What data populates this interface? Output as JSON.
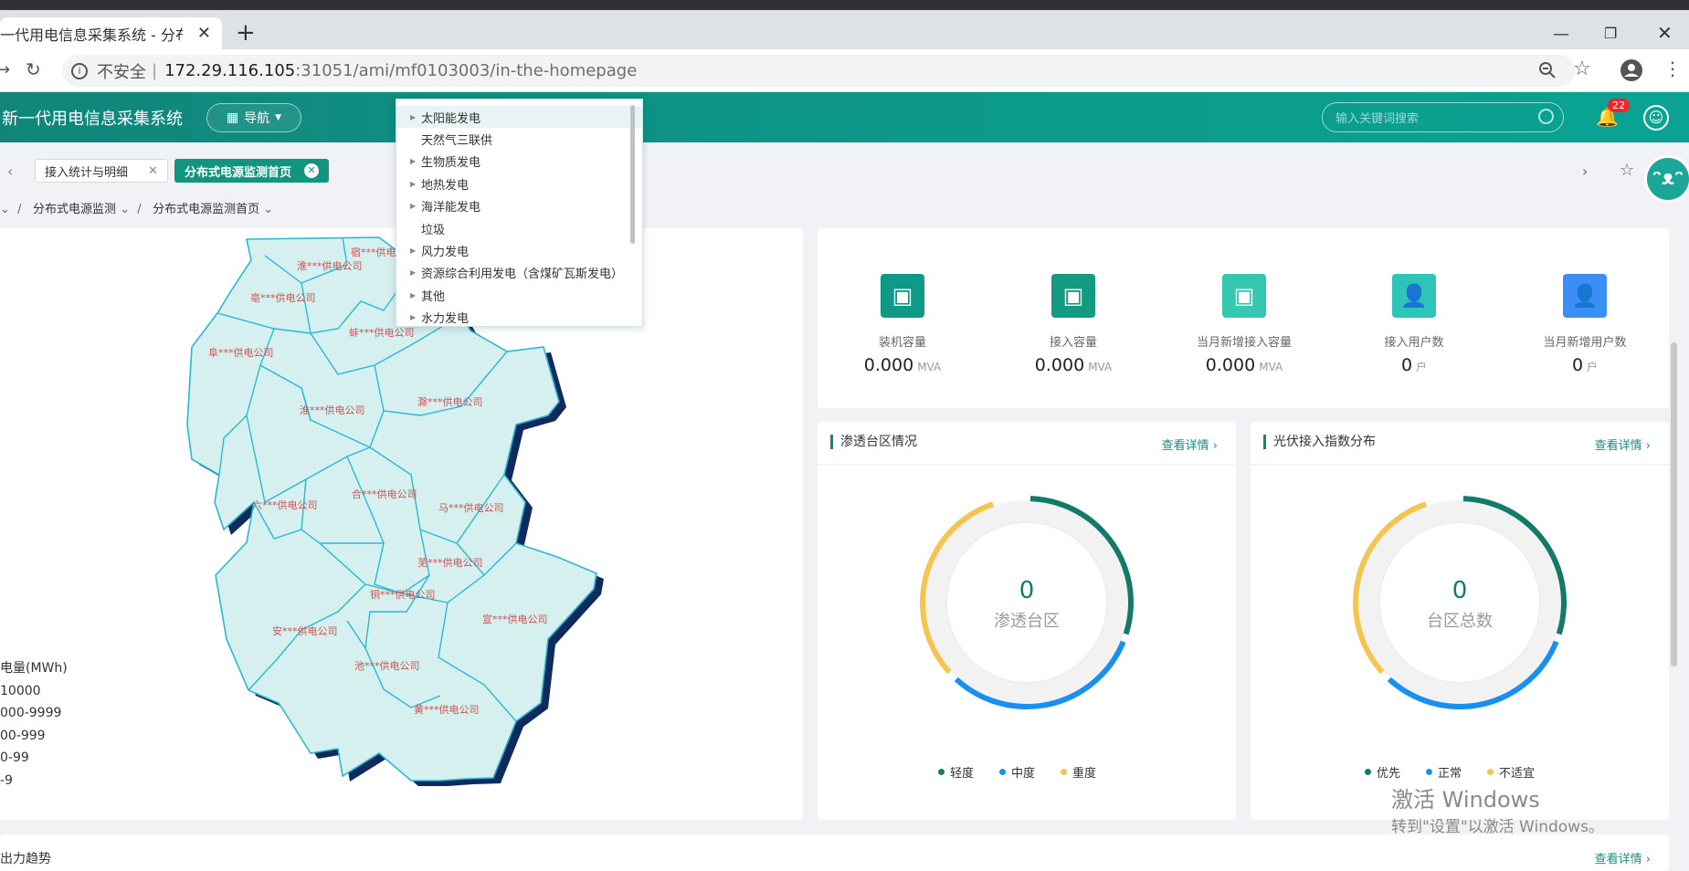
{
  "browser": {
    "tab_title": "一代用电信息采集系统 - 分布式",
    "url_insecure": "不安全",
    "url_host": "172.29.116.105",
    "url_rest": ":31051/ami/mf0103003/in-the-homepage"
  },
  "app": {
    "title": "新一代用电信息采集系统",
    "nav_label": "导航",
    "search_placeholder": "输入关键词搜索",
    "notification_count": "22"
  },
  "page_tabs": [
    {
      "label": "接入统计与明细",
      "active": false
    },
    {
      "label": "分布式电源监测首页",
      "active": true
    }
  ],
  "breadcrumb": [
    "分布式电源监测",
    "分布式电源监测首页"
  ],
  "dropdown_items": [
    {
      "label": "太阳能发电",
      "has_children": true
    },
    {
      "label": "天然气三联供",
      "has_children": false
    },
    {
      "label": "生物质发电",
      "has_children": true
    },
    {
      "label": "地热发电",
      "has_children": true
    },
    {
      "label": "海洋能发电",
      "has_children": true
    },
    {
      "label": "垃圾",
      "has_children": false
    },
    {
      "label": "风力发电",
      "has_children": true
    },
    {
      "label": "资源综合利用发电（含煤矿瓦斯发电）",
      "has_children": true
    },
    {
      "label": "其他",
      "has_children": true
    },
    {
      "label": "水力发电",
      "has_children": true
    }
  ],
  "map_regions": [
    "宿***供电公司",
    "淮***供电公司",
    "亳***供电公司",
    "阜***供电公司",
    "蚌***供电公司",
    "淮***供电公司",
    "滁***供电公司",
    "六***供电公司",
    "合***供电公司",
    "马***供电公司",
    "芜***供电公司",
    "铜***供电公司",
    "安***供电公司",
    "宣***供电公司",
    "池***供电公司",
    "黄***供电公司"
  ],
  "map_legend": {
    "title": "电量(MWh)",
    "ranges": [
      "10000",
      "000-9999",
      "00-999",
      "0-99",
      "-9"
    ]
  },
  "stats": [
    {
      "label": "装机容量",
      "value": "0.000",
      "unit": "MVA",
      "color": "#0e9a86"
    },
    {
      "label": "接入容量",
      "value": "0.000",
      "unit": "MVA",
      "color": "#129b80"
    },
    {
      "label": "当月新增接入容量",
      "value": "0.000",
      "unit": "MVA",
      "color": "#36c7b0"
    },
    {
      "label": "接入用户数",
      "value": "0",
      "unit": "户",
      "color": "#2fc4b8"
    },
    {
      "label": "当月新增用户数",
      "value": "0",
      "unit": "户",
      "color": "#3a8ef6"
    }
  ],
  "penetration": {
    "title": "渗透台区情况",
    "link": "查看详情",
    "center_value": "0",
    "center_label": "渗透台区",
    "legend": [
      {
        "label": "轻度",
        "color": "#137a69"
      },
      {
        "label": "中度",
        "color": "#1890f0"
      },
      {
        "label": "重度",
        "color": "#f4c551"
      }
    ]
  },
  "pv_index": {
    "title": "光伏接入指数分布",
    "link": "查看详情",
    "center_value": "0",
    "center_label": "台区总数",
    "legend": [
      {
        "label": "优先",
        "color": "#137a69"
      },
      {
        "label": "正常",
        "color": "#1890f0"
      },
      {
        "label": "不适宜",
        "color": "#f4c551"
      }
    ]
  },
  "bottom": {
    "title_partial": "出力趋势",
    "link": "查看详情"
  },
  "watermark": {
    "line1": "激活 Windows",
    "line2": "转到\"设置\"以激活 Windows。"
  }
}
